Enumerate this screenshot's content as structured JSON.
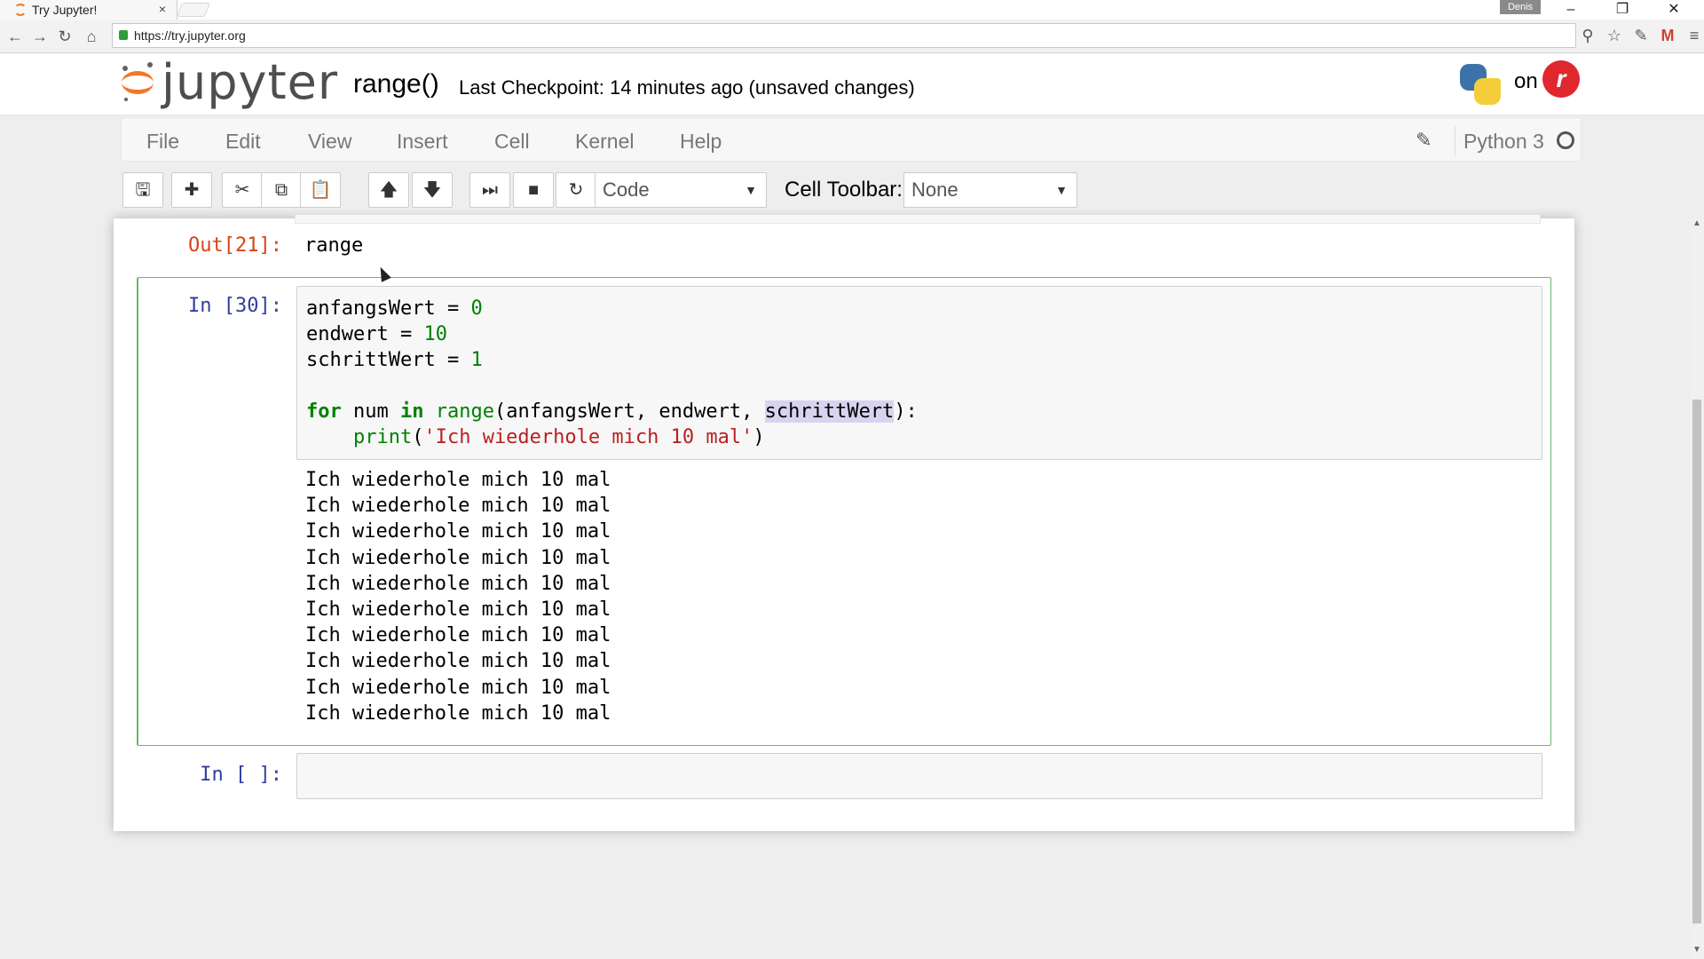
{
  "browser": {
    "tab_title": "Try Jupyter!",
    "tab_close": "×",
    "profile_name": "Denis",
    "url": "https://try.jupyter.org",
    "window_controls": [
      "–",
      "❐",
      "✕"
    ]
  },
  "header": {
    "logo_text": "jupyter",
    "notebook_name": "range()",
    "checkpoint": "Last Checkpoint: 14 minutes ago (unsaved changes)",
    "on_text": "on"
  },
  "menubar": {
    "items": [
      "File",
      "Edit",
      "View",
      "Insert",
      "Cell",
      "Kernel",
      "Help"
    ],
    "kernel_name": "Python 3"
  },
  "toolbar": {
    "cell_type": "Code",
    "cell_toolbar_label": "Cell Toolbar:",
    "cell_toolbar_value": "None"
  },
  "cells": {
    "prev_output_prompt": "Out[21]:",
    "prev_output_text": "range",
    "active_prompt": "In [30]:",
    "code_lines": {
      "l1a": "anfangsWert = ",
      "l1b": "0",
      "l2a": "endwert = ",
      "l2b": "10",
      "l3a": "schrittWert = ",
      "l3b": "1",
      "l5_for": "for",
      "l5_mid": " num ",
      "l5_in": "in",
      "l5_range": "range",
      "l5_args": "(anfangsWert, endwert, ",
      "l5_hl": "schrittWert",
      "l5_end": "):",
      "l6_print": "print",
      "l6_open": "(",
      "l6_str": "'Ich wiederhole mich 10 mal'",
      "l6_close": ")"
    },
    "output_lines": [
      "Ich wiederhole mich 10 mal",
      "Ich wiederhole mich 10 mal",
      "Ich wiederhole mich 10 mal",
      "Ich wiederhole mich 10 mal",
      "Ich wiederhole mich 10 mal",
      "Ich wiederhole mich 10 mal",
      "Ich wiederhole mich 10 mal",
      "Ich wiederhole mich 10 mal",
      "Ich wiederhole mich 10 mal",
      "Ich wiederhole mich 10 mal"
    ],
    "empty_prompt": "In [ ]:"
  },
  "colors": {
    "accent": "#f37726",
    "selected_border": "#66bb6a",
    "out_prompt": "#d84315",
    "in_prompt": "#303f9f"
  }
}
